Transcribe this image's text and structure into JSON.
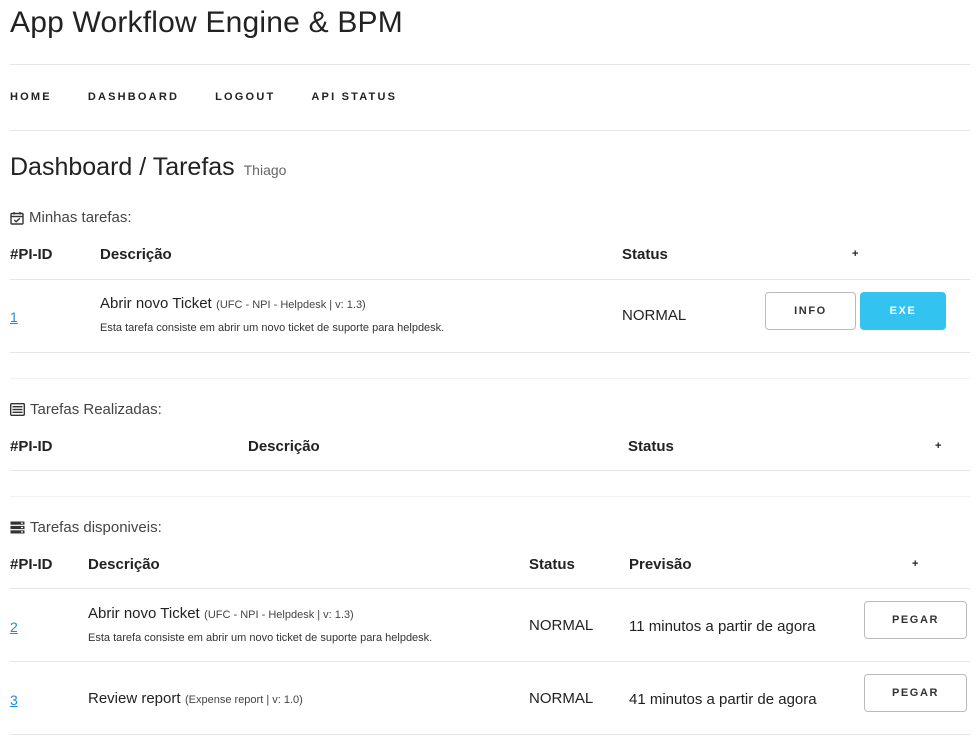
{
  "app": {
    "title": "App Workflow Engine & BPM"
  },
  "nav": {
    "items": [
      "HOME",
      "DASHBOARD",
      "LOGOUT",
      "API STATUS"
    ]
  },
  "page": {
    "title": "Dashboard / Tarefas",
    "user": "Thiago"
  },
  "my_tasks": {
    "title": "Minhas tarefas:",
    "icon": "calendar-check-icon",
    "headers": {
      "id": "#PI-ID",
      "desc": "Descrição",
      "status": "Status",
      "plus": "+"
    },
    "rows": [
      {
        "id": "1",
        "name": "Abrir novo Ticket",
        "meta": "(UFC - NPI - Helpdesk | v: 1.3)",
        "sub": "Esta tarefa consiste em abrir um novo ticket de suporte para helpdesk.",
        "status": "NORMAL",
        "btn_info": "INFO",
        "btn_exe": "EXE"
      }
    ]
  },
  "done_tasks": {
    "title": "Tarefas Realizadas:",
    "icon": "list-alt-icon",
    "headers": {
      "id": "#PI-ID",
      "desc": "Descrição",
      "status": "Status",
      "plus": "+"
    }
  },
  "available_tasks": {
    "title": "Tarefas disponiveis:",
    "icon": "server-icon",
    "headers": {
      "id": "#PI-ID",
      "desc": "Descrição",
      "status": "Status",
      "prev": "Previsão",
      "plus": "+"
    },
    "rows": [
      {
        "id": "2",
        "name": "Abrir novo Ticket",
        "meta": "(UFC - NPI - Helpdesk | v: 1.3)",
        "sub": "Esta tarefa consiste em abrir um novo ticket de suporte para helpdesk.",
        "status": "NORMAL",
        "prev": "11 minutos a partir de agora",
        "btn": "PEGAR"
      },
      {
        "id": "3",
        "name": "Review report",
        "meta": "(Expense report | v: 1.0)",
        "sub": "",
        "status": "NORMAL",
        "prev": "41 minutos a partir de agora",
        "btn": "PEGAR"
      }
    ]
  },
  "colors": {
    "accent": "#33c3f0",
    "link": "#1a8ed8",
    "divider": "#e6e6e6"
  }
}
